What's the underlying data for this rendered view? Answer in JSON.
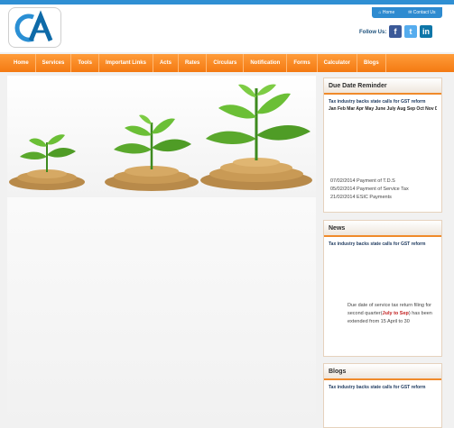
{
  "header": {
    "top_links": {
      "home": "Home",
      "contact": "Contact Us"
    },
    "follow_label": "Follow Us:",
    "social": {
      "facebook": "f",
      "twitter": "t",
      "linkedin": "in"
    },
    "logo_text": "CA"
  },
  "nav": {
    "items": [
      "Home",
      "Services",
      "Tools",
      "Important Links",
      "Acts",
      "Rates",
      "Circulars",
      "Notification",
      "Forms",
      "Calculator",
      "Blogs"
    ]
  },
  "sidebar": {
    "due_date": {
      "title": "Due Date Reminder",
      "headline": "Tax industry backs state calls for GST reform",
      "months": "Jan Feb Mar Apr May June July Aug Sep Oct Nov Dec",
      "items": [
        "07/02/2014 Payment of T.D.S",
        "05/02/2014 Payment of Service Tax",
        "21/02/2014 ESIC Payments"
      ]
    },
    "news": {
      "title": "News",
      "headline": "Tax industry backs state calls for GST reform",
      "text_before": "Due date of service tax return filing for second quarter(",
      "text_red": "July to Sep",
      "text_after": ") has been extended from 15 April to 30"
    },
    "blogs": {
      "title": "Blogs",
      "headline": "Tax industry backs state calls for GST reform"
    }
  },
  "colors": {
    "accent": "#f47a12",
    "blue": "#2f8fd3"
  }
}
